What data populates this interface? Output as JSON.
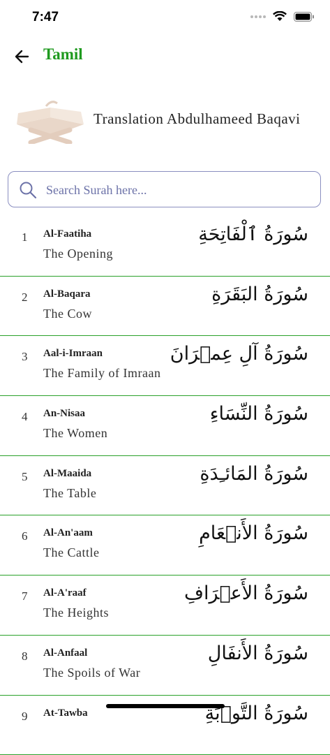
{
  "status": {
    "time": "7:47"
  },
  "header": {
    "title": "Tamil",
    "back_icon": "arrow-left-icon"
  },
  "translator": {
    "name": "Translation Abdulhameed Baqavi",
    "icon": "quran-book-stand-icon"
  },
  "search": {
    "placeholder": "Search Surah here...",
    "value": ""
  },
  "colors": {
    "accent": "#1f9a1f",
    "divider": "#2aa12a",
    "search_border": "#8a8ec0",
    "placeholder": "#6c72a8"
  },
  "surahs": [
    {
      "number": "1",
      "name": "Al-Faatiha",
      "meaning": "The Opening",
      "arabic": "سُورَةُ ٱلْفَاتِحَةِ"
    },
    {
      "number": "2",
      "name": "Al-Baqara",
      "meaning": "The Cow",
      "arabic": "سُورَةُ البَقَرَةِ"
    },
    {
      "number": "3",
      "name": "Aal-i-Imraan",
      "meaning": "The Family of Imraan",
      "arabic": "سُورَةُ آلِ عِمۡرَانَ"
    },
    {
      "number": "4",
      "name": "An-Nisaa",
      "meaning": "The Women",
      "arabic": "سُورَةُ النِّسَاءِ"
    },
    {
      "number": "5",
      "name": "Al-Maaida",
      "meaning": "The Table",
      "arabic": "سُورَةُ المَائـِدَةِ"
    },
    {
      "number": "6",
      "name": "Al-An'aam",
      "meaning": "The Cattle",
      "arabic": "سُورَةُ الأَنۡعَامِ"
    },
    {
      "number": "7",
      "name": "Al-A'raaf",
      "meaning": "The Heights",
      "arabic": "سُورَةُ الأَعۡرَافِ"
    },
    {
      "number": "8",
      "name": "Al-Anfaal",
      "meaning": "The Spoils of War",
      "arabic": "سُورَةُ الأَنفَالِ"
    },
    {
      "number": "9",
      "name": "At-Tawba",
      "meaning": "",
      "arabic": "سُورَةُ التَّوۡبَةِ"
    }
  ]
}
